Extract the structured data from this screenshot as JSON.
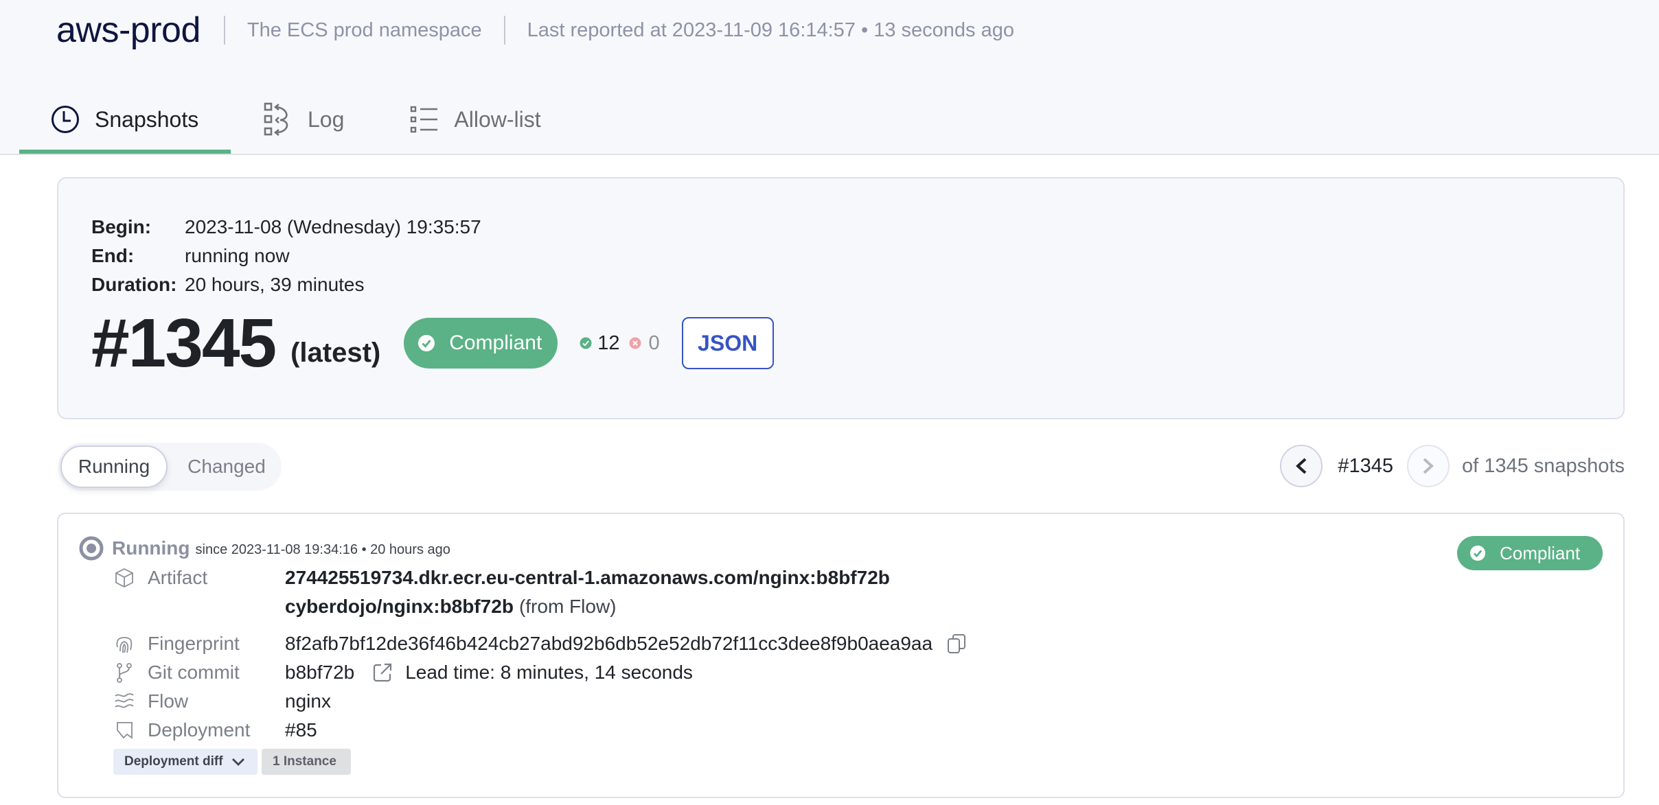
{
  "header": {
    "title": "aws-prod",
    "description": "The ECS prod namespace",
    "last_reported": "Last reported at 2023-11-09 16:14:57 • 13 seconds ago"
  },
  "tabs": [
    {
      "label": "Snapshots",
      "icon": "clock-icon",
      "active": true
    },
    {
      "label": "Log",
      "icon": "log-icon",
      "active": false
    },
    {
      "label": "Allow-list",
      "icon": "list-icon",
      "active": false
    }
  ],
  "summary": {
    "begin_label": "Begin:",
    "begin_value": "2023-11-08 (Wednesday) 19:35:57",
    "end_label": "End:",
    "end_value": "running now",
    "duration_label": "Duration:",
    "duration_value": "20 hours, 39 minutes",
    "snapshot_number": "#1345",
    "latest_label": "(latest)",
    "status": "Compliant",
    "compliant_count": "12",
    "noncompliant_count": "0",
    "json_button": "JSON"
  },
  "view_toggle": {
    "options": [
      "Running",
      "Changed"
    ],
    "selected": "Running"
  },
  "pager": {
    "prev": "<",
    "current": "#1345",
    "next": ">",
    "total": "of 1345 snapshots"
  },
  "running_card": {
    "state": "Running",
    "since": "since 2023-11-08 19:34:16 • 20 hours ago",
    "status": "Compliant",
    "fields": {
      "artifact_label": "Artifact",
      "artifact_name": "274425519734.dkr.ecr.eu-central-1.amazonaws.com/nginx:b8bf72b",
      "artifact_flow_name": "cyberdojo/nginx:b8bf72b",
      "artifact_flow_suffix": "(from Flow)",
      "fingerprint_label": "Fingerprint",
      "fingerprint_value": "8f2afb7bf12de36f46b424cb27abd92b6db52e52db72f11cc3dee8f9b0aea9aa",
      "git_label": "Git commit",
      "git_value": "b8bf72b",
      "lead_time": "Lead time: 8 minutes, 14 seconds",
      "flow_label": "Flow",
      "flow_value": "nginx",
      "deployment_label": "Deployment",
      "deployment_value": "#85"
    },
    "chips": {
      "diff": "Deployment diff",
      "instances": "1 Instance"
    }
  },
  "colors": {
    "accent_green": "#5ab286",
    "link_blue": "#3654c4",
    "title_navy": "#0e1540",
    "muted": "#8d93a6"
  }
}
